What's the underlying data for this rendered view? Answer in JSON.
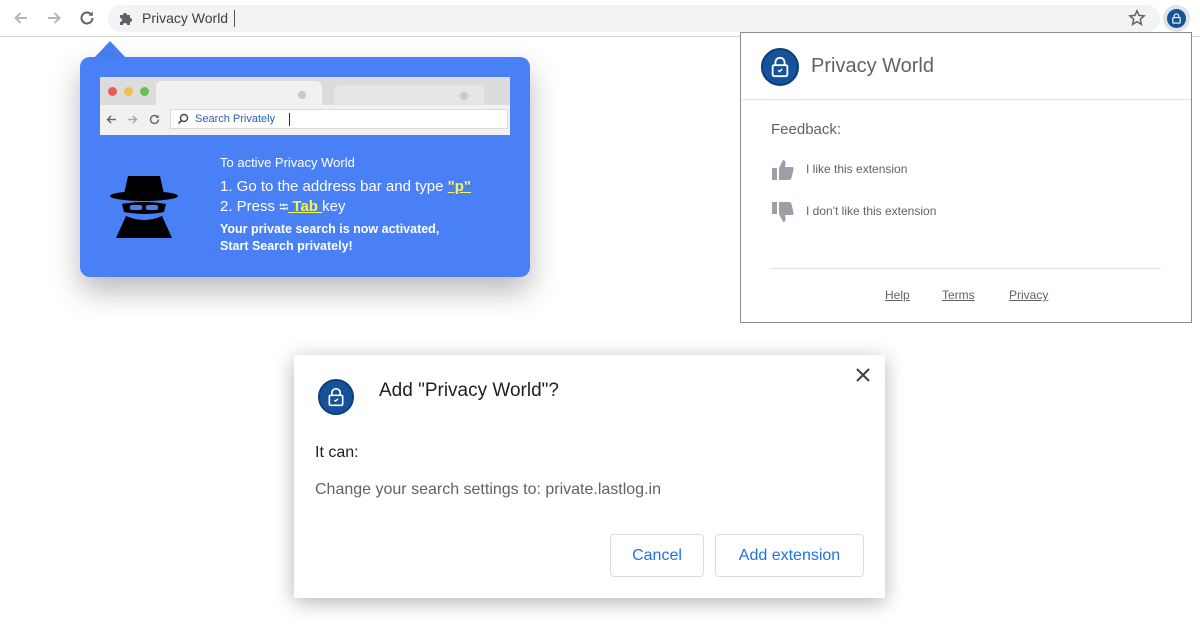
{
  "browser": {
    "omnibox_text": "Privacy World",
    "omnibox_icon": "puzzle-icon",
    "accent": "#1a73e8"
  },
  "tooltip": {
    "mini_search_text": "Search Privately",
    "intro": "To active Privacy World",
    "step1_prefix": "1. Go to the address bar and type ",
    "step1_key": "\"p\"",
    "step2_prefix": "2. Press ",
    "step2_tab_glyph": "⭾",
    "step2_key": " Tab ",
    "step2_suffix": "key",
    "activated_line1": "Your private search is now activated,",
    "activated_line2": "Start Search privately!",
    "background_color": "#4a80f5",
    "highlight_color": "#f6f54b"
  },
  "popup": {
    "title": "Privacy World",
    "feedback_label": "Feedback:",
    "like_text": "I like this extension",
    "dislike_text": "I don't like this extension",
    "links": [
      "Help",
      "Terms",
      "Privacy"
    ]
  },
  "dialog": {
    "title": "Add \"Privacy World\"?",
    "it_can": "It can:",
    "permission": "Change your search settings to: private.lastlog.in",
    "cancel_label": "Cancel",
    "add_label": "Add extension"
  }
}
